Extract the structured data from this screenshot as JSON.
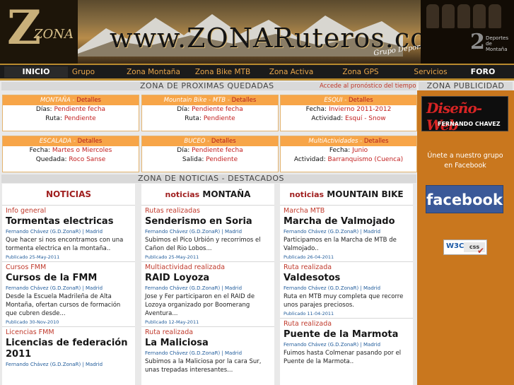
{
  "header": {
    "logo_text": "ZONA",
    "site_title": "www.ZONARuteros.com",
    "subtitle": "Grupo Deportivo ZonaR",
    "badge_sub": "Deportes de Montaña"
  },
  "nav": [
    {
      "label": "INICIO"
    },
    {
      "label": "Grupo"
    },
    {
      "label": "Zona Montaña"
    },
    {
      "label": "Zona Bike MTB"
    },
    {
      "label": "Zona Activa"
    },
    {
      "label": "Zona GPS"
    },
    {
      "label": "Servicios"
    },
    {
      "label": "FORO"
    }
  ],
  "quedadas": {
    "heading": "ZONA DE PROXIMAS QUEDADAS",
    "forecast_link": "Accede al pronóstico del tiempo",
    "boxes": [
      {
        "title": "MONTAÑA",
        "details": "Detalles",
        "rows": [
          {
            "k": "Días:",
            "v": "Pendiente fecha"
          },
          {
            "k": "Ruta:",
            "v": "Pendiente"
          }
        ]
      },
      {
        "title": "Mountain Bike - MTB",
        "details": "Detalles",
        "rows": [
          {
            "k": "Día:",
            "v": "Pendiente fecha"
          },
          {
            "k": "Ruta:",
            "v": "Pendiente"
          }
        ]
      },
      {
        "title": "ESQUI",
        "details": "Detalles",
        "rows": [
          {
            "k": "Fecha:",
            "v": "Invierno 2011-2012"
          },
          {
            "k": "Actividad:",
            "v": "Esquí - Snow"
          }
        ]
      },
      {
        "title": "ESCALADA",
        "details": "Detalles",
        "rows": [
          {
            "k": "Fecha:",
            "v": "Martes o Miercoles"
          },
          {
            "k": "Quedada:",
            "v": "Roco Sanse"
          }
        ]
      },
      {
        "title": "BUCEO",
        "details": "Detalles",
        "rows": [
          {
            "k": "Día:",
            "v": "Pendiente fecha"
          },
          {
            "k": "Salida:",
            "v": "Pendiente"
          }
        ]
      },
      {
        "title": "MultiActividades",
        "details": "Detalles",
        "rows": [
          {
            "k": "Fecha:",
            "v": "Junio"
          },
          {
            "k": "Actividad:",
            "v": "Barranquismo (Cuenca)"
          }
        ]
      }
    ]
  },
  "noticias": {
    "heading": "ZONA DE NOTICIAS - DESTACADOS",
    "columns": [
      {
        "pre": "",
        "main": "NOTICIAS",
        "items": [
          {
            "cat": "Info general",
            "title": "Tormentas electricas",
            "author": "Fernando Chávez (G.D.ZonaR) | Madrid",
            "body": "Que hacer si nos encontramos con una tormenta electrica en la montaña..",
            "pub": "Publicado 25-May-2011"
          },
          {
            "cat": "Cursos FMM",
            "title": "Cursos de la FMM",
            "author": "Fernando Chávez (G.D.ZonaR) | Madrid",
            "body": "Desde la Escuela Madrileña de Alta Montaña, ofertan cursos de formación que cubren desde...",
            "pub": "Publicado 30-Nov-2010"
          },
          {
            "cat": "Licencias FMM",
            "title": "Licencias de federación 2011",
            "author": "Fernando Chávez (G.D.ZonaR) | Madrid",
            "body": "",
            "pub": ""
          }
        ]
      },
      {
        "pre": "noticias",
        "main": "MONTAÑA",
        "items": [
          {
            "cat": "Rutas realizadas",
            "title": "Senderismo en Soria",
            "author": "Fernando Chávez (G.D.ZonaR) | Madrid",
            "body": "Subimos el Pico Urbión y recorrimos el Cañon del Rio Lobos...",
            "pub": "Publicado 25-May-2011"
          },
          {
            "cat": "Multiactividad realizada",
            "title": "RAID Loyoza",
            "author": "Fernando Chávez (G.D.ZonaR) | Madrid",
            "body": "Jose y Fer participaron en el RAID de Lozoya organizado por Boomerang Aventura...",
            "pub": "Publicado 12-May-2011"
          },
          {
            "cat": "Ruta realizada",
            "title": "La Maliciosa",
            "author": "Fernando Chávez (G.D.ZonaR) | Madrid",
            "body": "Subimos a la Maliciosa por la cara Sur, unas trepadas interesantes...",
            "pub": ""
          }
        ]
      },
      {
        "pre": "noticias",
        "main": "MOUNTAIN BIKE",
        "items": [
          {
            "cat": "Marcha MTB",
            "title": "Marcha de Valmojado",
            "author": "Fernando Chávez (G.D.ZonaR) | Madrid",
            "body": "Participamos en la Marcha de MTB de Valmojado..",
            "pub": "Publicado 26-04-2011"
          },
          {
            "cat": "Ruta realizada",
            "title": "Valdesotos",
            "author": "Fernando Chávez (G.D.ZonaR) | Madrid",
            "body": "Ruta en MTB muy completa que recorre unos parajes preciosos.",
            "pub": "Publicado 11-04-2011"
          },
          {
            "cat": "Ruta realizada",
            "title": "Puente de la Marmota",
            "author": "Fernando Chávez (G.D.ZonaR) | Madrid",
            "body": "Fuimos hasta Colmenar pasando por el Puente de la Marmota..",
            "pub": ""
          }
        ]
      }
    ]
  },
  "publicidad": {
    "heading": "ZONA PUBLICIDAD",
    "diseno_title": "Diseño-Web",
    "diseno_sub": "FERNANDO CHAVEZ",
    "join_text": "Únete a nuestro grupo en Facebook",
    "facebook_label": "facebook",
    "w3c_label": "W3C",
    "css_label": "css"
  }
}
